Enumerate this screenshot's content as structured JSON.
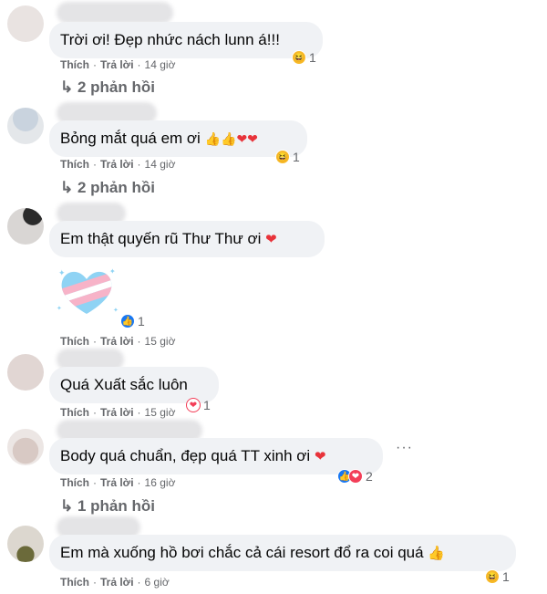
{
  "comments": [
    {
      "text": "Trời ơi! Đẹp nhức nách lunn á!!!",
      "actions": {
        "like": "Thích",
        "reply": "Trả lời",
        "time": "14 giờ"
      },
      "reaction": {
        "icon": "haha-icon",
        "count": "1"
      },
      "replies": "↳ 2 phản hồi"
    },
    {
      "text": "Bỏng mắt quá em ơi",
      "emoji": "👍👍❤❤",
      "actions": {
        "like": "Thích",
        "reply": "Trả lời",
        "time": "14 giờ"
      },
      "reaction": {
        "icon": "haha-icon",
        "count": "1"
      },
      "replies": "↳ 2 phản hồi"
    },
    {
      "text": "Em thật quyến rũ Thư Thư ơi",
      "emoji": "❤",
      "sticker": "pastel-heart-sticker",
      "actions": {
        "like": "Thích",
        "reply": "Trả lời",
        "time": "15 giờ"
      },
      "reaction": {
        "icon": "like-icon",
        "count": "1"
      }
    },
    {
      "text": "Quá Xuất sắc luôn",
      "actions": {
        "like": "Thích",
        "reply": "Trả lời",
        "time": "15 giờ"
      },
      "reaction": {
        "icon": "love-icon",
        "count": "1"
      }
    },
    {
      "text": "Body quá chuẩn, đẹp quá TT xinh ơi",
      "emoji": "❤",
      "more": "···",
      "actions": {
        "like": "Thích",
        "reply": "Trả lời",
        "time": "16 giờ"
      },
      "reaction": {
        "icon": "like-love-icons",
        "count": "2"
      },
      "replies": "↳ 1 phản hồi"
    },
    {
      "text": "Em mà xuống hồ bơi chắc cả cái resort đổ ra coi quá",
      "emoji": "👍",
      "actions": {
        "like": "Thích",
        "reply": "Trả lời",
        "time": "6 giờ"
      },
      "reaction": {
        "icon": "haha-icon",
        "count": "1"
      }
    }
  ],
  "colors": {
    "bubble": "#f0f2f5",
    "meta": "#65676b",
    "like": "#1877f2",
    "love": "#f33e58",
    "haha": "#f7b928"
  }
}
